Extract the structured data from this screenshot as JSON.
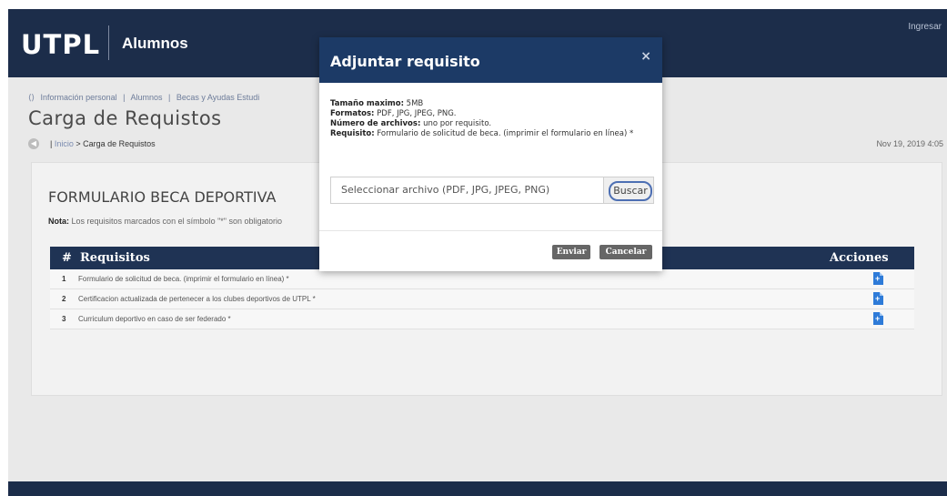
{
  "header": {
    "logo": "UTPL",
    "subtitle": "Alumnos",
    "login": "Ingresar"
  },
  "crumbs": [
    "Información personal",
    "Alumnos",
    "Becas y Ayudas Estudi"
  ],
  "page": {
    "title": "Carga de Requistos",
    "breadcrumb_home": "Inicio",
    "breadcrumb_current": "> Carga de Requistos",
    "date": "Nov 19, 2019 4:05"
  },
  "panel": {
    "title": "FORMULARIO BECA DEPORTIVA",
    "note_label": "Nota:",
    "note_text": "Los requisitos marcados con el símbolo \"*\" son obligatorio"
  },
  "table": {
    "col_num": "#",
    "col_req": "Requisitos",
    "col_actions": "Acciones",
    "rows": [
      {
        "num": "1",
        "text": "Formulario de solicitud de beca. (imprimir el formulario en línea) *"
      },
      {
        "num": "2",
        "text": "Certificacion actualizada de pertenecer a los clubes deportivos de UTPL *"
      },
      {
        "num": "3",
        "text": "Curriculum deportivo en caso de ser federado *"
      }
    ]
  },
  "modal": {
    "title": "Adjuntar requisito",
    "close": "×",
    "size_label": "Tamaño maximo:",
    "size_value": "5MB",
    "formats_label": "Formatos:",
    "formats_value": "PDF, JPG, JPEG, PNG.",
    "files_label": "Número de archivos:",
    "files_value": "uno por requisito.",
    "req_label": "Requisito:",
    "req_value": "Formulario de solicitud de beca. (imprimir el formulario en línea) *",
    "file_placeholder": "Seleccionar archivo (PDF, JPG, JPEG, PNG)",
    "browse": "Buscar",
    "send": "Enviar",
    "cancel": "Cancelar"
  },
  "colors": {
    "header_bg": "#1c2d4a",
    "modal_header": "#1c3a66",
    "table_header": "#1f3354",
    "file_icon": "#2e7bd8"
  }
}
